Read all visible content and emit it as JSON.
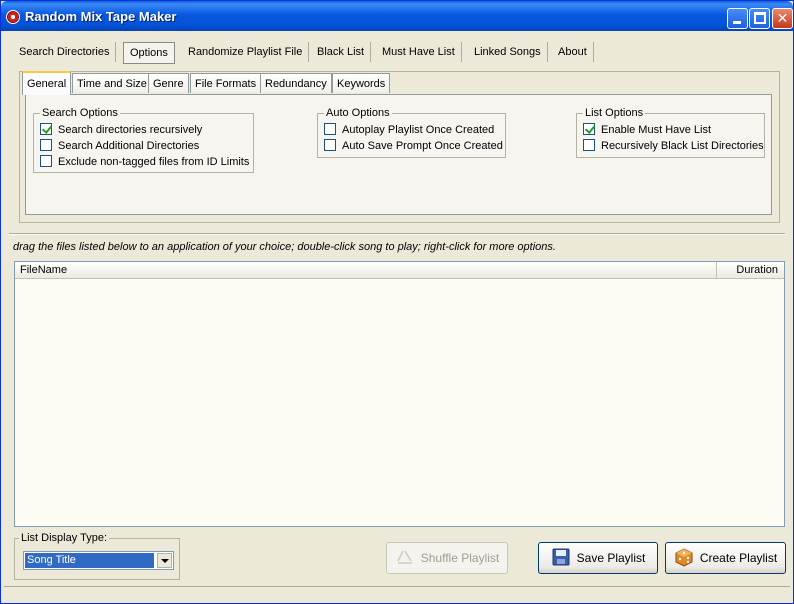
{
  "window": {
    "title": "Random Mix Tape Maker"
  },
  "main_tabs": [
    {
      "label": "Search Directories"
    },
    {
      "label": "Options"
    },
    {
      "label": "Randomize Playlist File"
    },
    {
      "label": "Black List"
    },
    {
      "label": "Must Have List"
    },
    {
      "label": "Linked Songs"
    },
    {
      "label": "About"
    }
  ],
  "sub_tabs": [
    {
      "label": "General"
    },
    {
      "label": "Time and Size"
    },
    {
      "label": "Genre"
    },
    {
      "label": "File Formats"
    },
    {
      "label": "Redundancy"
    },
    {
      "label": "Keywords"
    }
  ],
  "search_options": {
    "legend": "Search Options",
    "items": [
      {
        "label": "Search directories recursively",
        "checked": true
      },
      {
        "label": "Search Additional Directories",
        "checked": false
      },
      {
        "label": "Exclude non-tagged files from ID Limits",
        "checked": false
      }
    ]
  },
  "auto_options": {
    "legend": "Auto Options",
    "items": [
      {
        "label": "Autoplay Playlist Once Created",
        "checked": false
      },
      {
        "label": "Auto Save Prompt Once Created",
        "checked": false
      }
    ]
  },
  "list_options": {
    "legend": "List Options",
    "items": [
      {
        "label": "Enable Must Have List",
        "checked": true
      },
      {
        "label": "Recursively Black List Directories",
        "checked": false
      }
    ]
  },
  "hint": "drag the files listed below to an application of your choice; double-click song to play; right-click for more options.",
  "file_list": {
    "col_filename": "FileName",
    "col_duration": "Duration",
    "rows": []
  },
  "display_type": {
    "legend": "List Display Type:",
    "selected": "Song Title"
  },
  "buttons": {
    "shuffle": "Shuffle Playlist",
    "save": "Save Playlist",
    "create": "Create Playlist"
  },
  "colors": {
    "titlebar": "#0552d8",
    "selection": "#316ac5",
    "list_bg": "#fdfcf3"
  }
}
